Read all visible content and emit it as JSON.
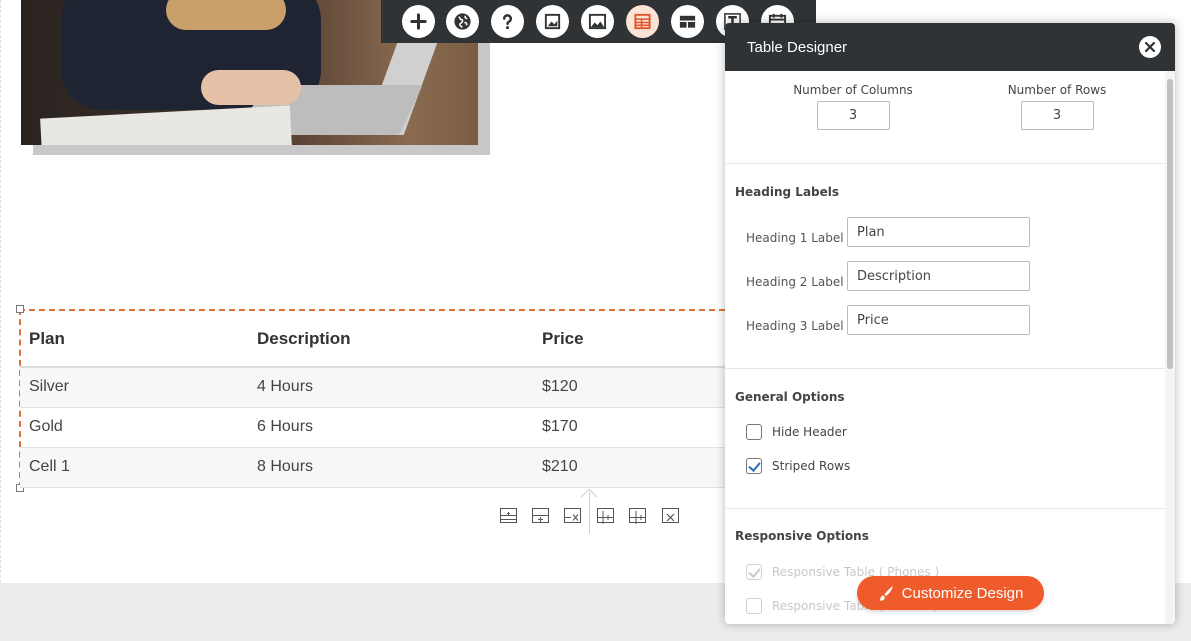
{
  "toolbar": {
    "buttons": [
      {
        "icon": "plus-icon",
        "active": false
      },
      {
        "icon": "globe-icon",
        "active": false
      },
      {
        "icon": "question-icon",
        "active": false
      },
      {
        "icon": "image-icon",
        "active": false
      },
      {
        "icon": "gallery-icon",
        "active": false
      },
      {
        "icon": "table-icon",
        "active": true
      },
      {
        "icon": "layout-icon",
        "active": false
      },
      {
        "icon": "text-icon",
        "active": false
      },
      {
        "icon": "calendar-icon",
        "active": false
      }
    ]
  },
  "table": {
    "headers": [
      "Plan",
      "Description",
      "Price"
    ],
    "rows": [
      [
        "Silver",
        "4 Hours",
        "$120"
      ],
      [
        "Gold",
        "6 Hours",
        "$170"
      ],
      [
        "Cell 1",
        "8 Hours",
        "$210"
      ]
    ],
    "tools": [
      "insert-row-above-icon",
      "insert-row-below-icon",
      "delete-row-icon",
      "insert-column-left-icon",
      "insert-column-right-icon",
      "delete-column-icon"
    ]
  },
  "panel": {
    "title": "Table Designer",
    "columns_label": "Number of Columns",
    "columns_value": "3",
    "rows_label": "Number of Rows",
    "rows_value": "3",
    "heading_section": "Heading Labels",
    "headings": [
      {
        "label": "Heading 1 Label",
        "value": "Plan"
      },
      {
        "label": "Heading 2 Label",
        "value": "Description"
      },
      {
        "label": "Heading 3 Label",
        "value": "Price"
      }
    ],
    "general_section": "General Options",
    "hide_header": "Hide Header",
    "striped_rows": "Striped Rows",
    "responsive_section": "Responsive Options",
    "responsive_phones": "Responsive Table ( Phones )",
    "responsive_tablets": "Responsive Table ( Tablets )",
    "customize_button": "Customize Design"
  },
  "colors": {
    "accent": "#ef5b2b",
    "dark_bar": "#2f3335",
    "selection_border": "#e0703a"
  }
}
